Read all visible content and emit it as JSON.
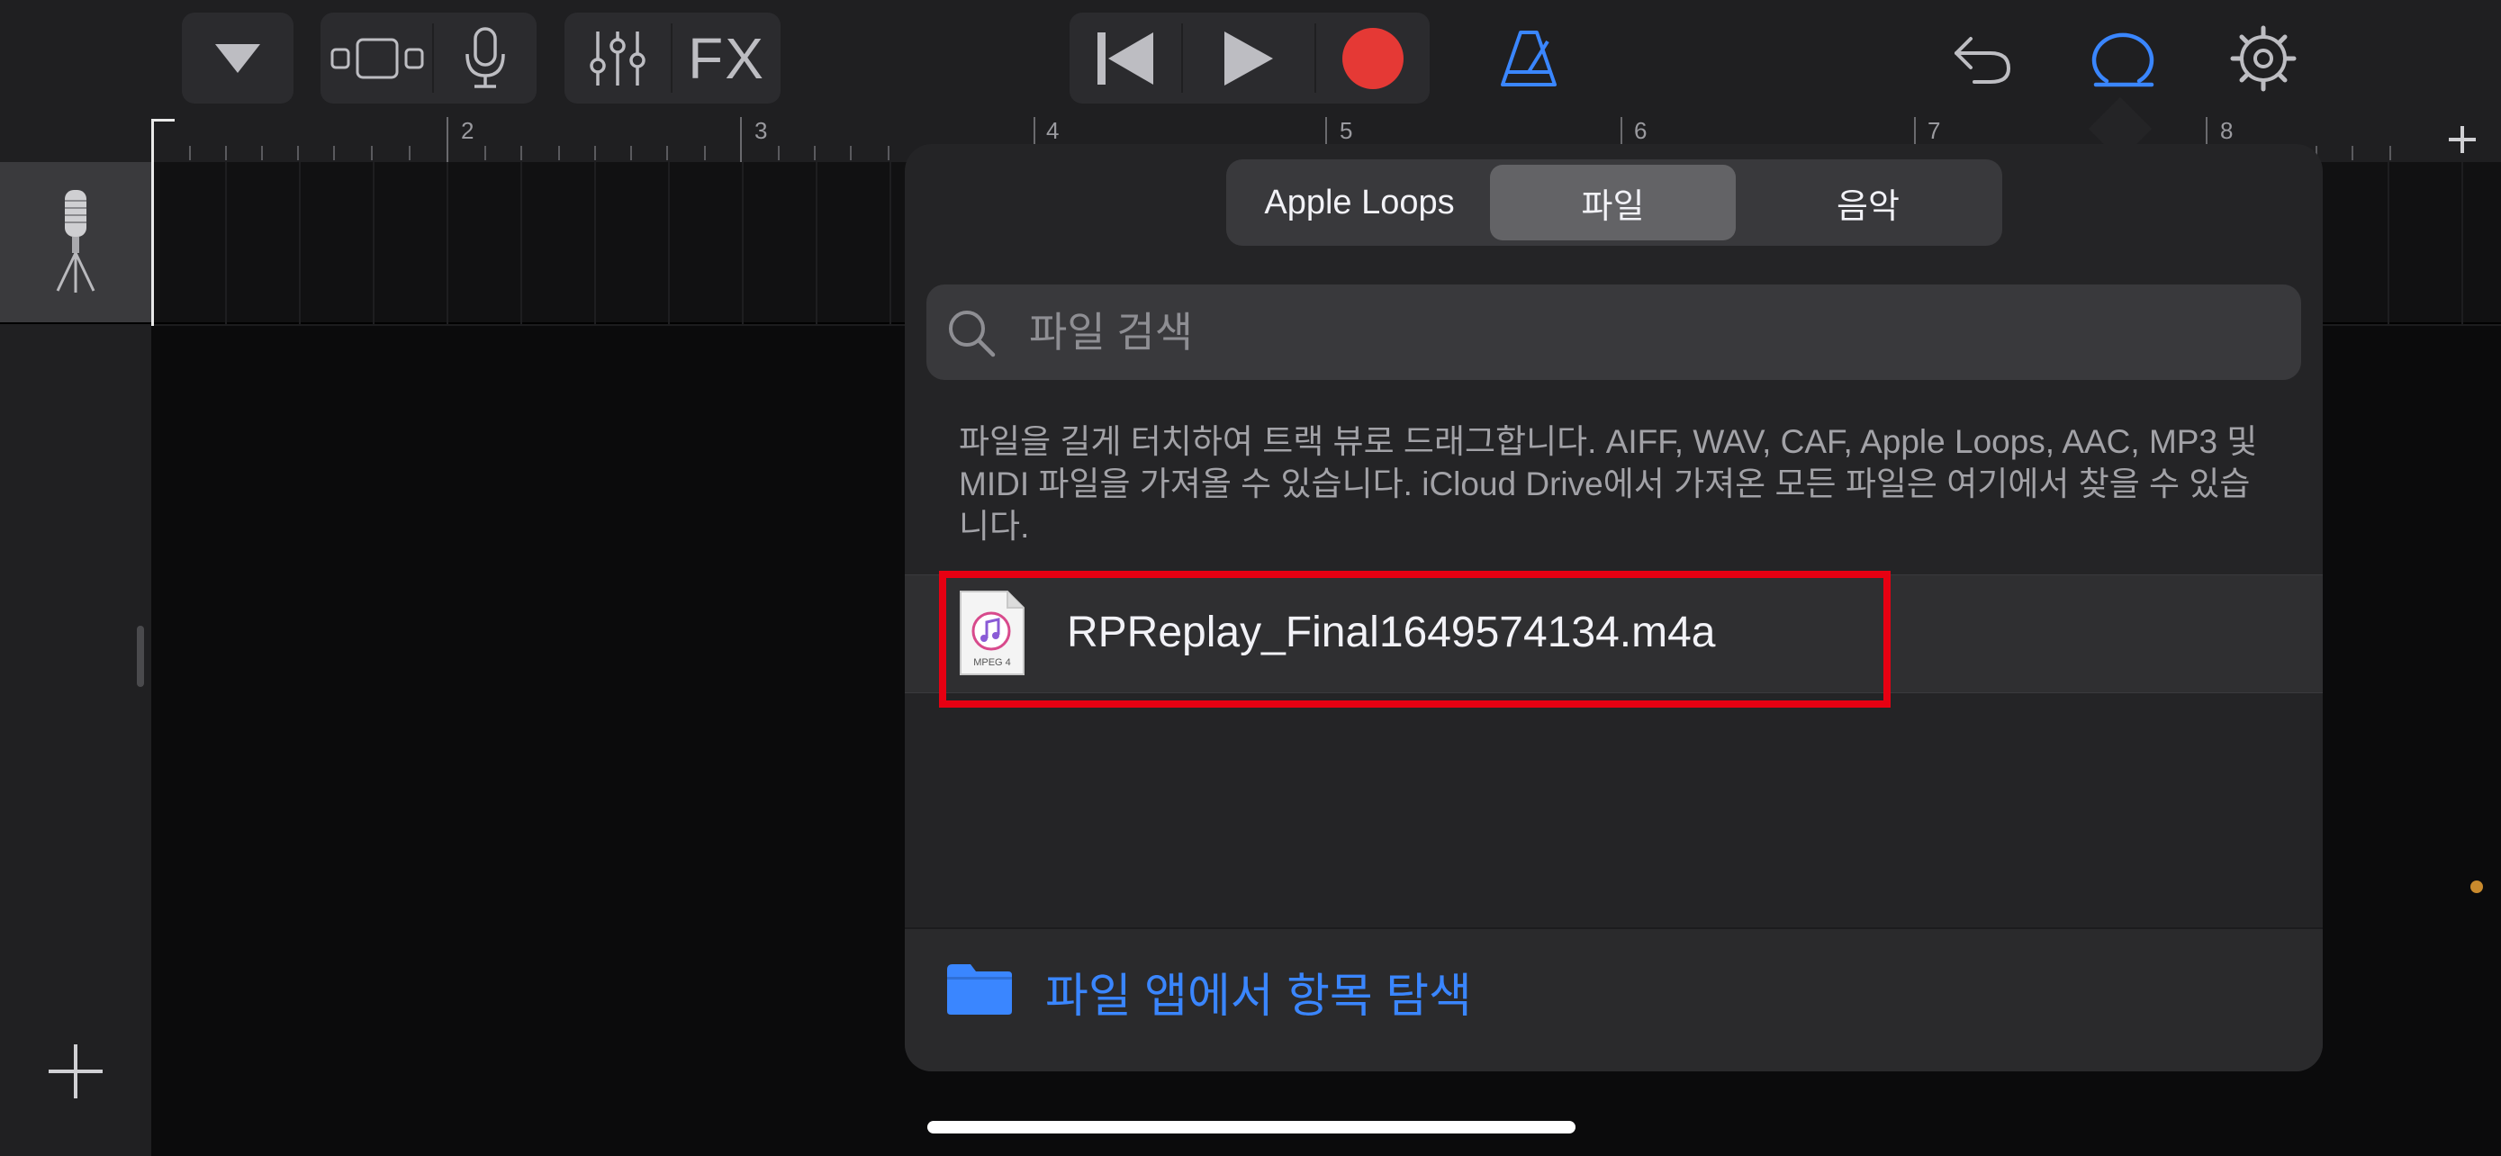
{
  "toolbar": {
    "fx_label": "FX",
    "icons": [
      "dropdown-triangle-icon",
      "track-view-icon",
      "microphone-icon",
      "mixer-sliders-icon",
      "go-to-beginning-icon",
      "play-icon",
      "record-icon",
      "metronome-icon",
      "undo-icon",
      "loop-browser-icon",
      "settings-gear-icon"
    ],
    "colors": {
      "record": "#e53935",
      "accent": "#3a86ff",
      "icon": "#bdbdc2"
    }
  },
  "ruler": {
    "bars": [
      "2",
      "3",
      "4",
      "5",
      "6",
      "7",
      "8"
    ]
  },
  "popover": {
    "tabs": [
      "Apple Loops",
      "파일",
      "음악"
    ],
    "active_tab": "파일",
    "search_placeholder": "파일 검색",
    "info_text": "파일을 길게 터치하여 트랙 뷰로 드래그합니다. AIFF, WAV, CAF, Apple Loops, AAC, MP3 및 MIDI 파일을 가져올 수 있습니다. iCloud Drive에서 가져온 모든 파일은 여기에서 찾을 수 있습니다.",
    "files": [
      {
        "name": "RPReplay_Final1649574134.m4a",
        "icon_label": "MPEG 4"
      }
    ],
    "highlight_color": "#e60012",
    "browse_label": "파일 앱에서 항목 탐색"
  }
}
